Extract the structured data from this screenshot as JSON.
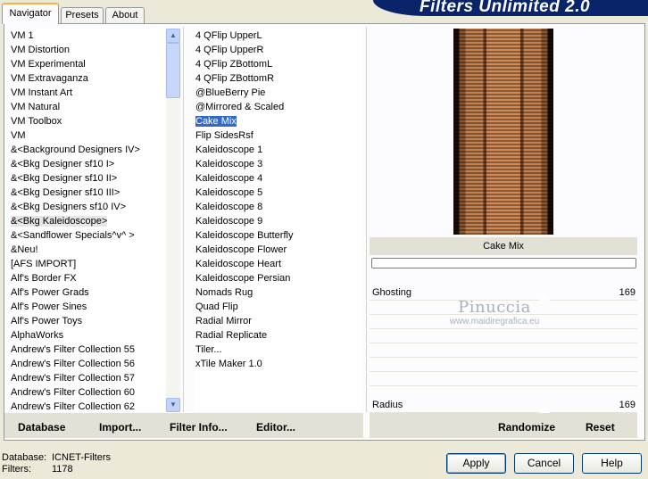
{
  "tabs": [
    "Navigator",
    "Presets",
    "About"
  ],
  "banner_title": "Filters Unlimited 2.0",
  "categories": [
    "VM 1",
    "VM Distortion",
    "VM Experimental",
    "VM Extravaganza",
    "VM Instant Art",
    "VM Natural",
    "VM Toolbox",
    "VM",
    "&<Background Designers IV>",
    "&<Bkg Designer sf10 I>",
    "&<Bkg Designer sf10 II>",
    "&<Bkg Designer sf10 III>",
    "&<Bkg Designers sf10 IV>",
    "&<Bkg Kaleidoscope>",
    "&<Sandflower Specials^v^ >",
    "&Neu!",
    "[AFS IMPORT]",
    "Alf's Border FX",
    "Alf's Power Grads",
    "Alf's Power Sines",
    "Alf's Power Toys",
    "AlphaWorks",
    "Andrew's Filter Collection 55",
    "Andrew's Filter Collection 56",
    "Andrew's Filter Collection 57",
    "Andrew's Filter Collection 60",
    "Andrew's Filter Collection 62"
  ],
  "selected_category": "&<Bkg Kaleidoscope>",
  "filters": [
    "4 QFlip UpperL",
    "4 QFlip UpperR",
    "4 QFlip ZBottomL",
    "4 QFlip ZBottomR",
    "@BlueBerry Pie",
    "@Mirrored & Scaled",
    "Cake Mix",
    "Flip SidesRsf",
    "Kaleidoscope 1",
    "Kaleidoscope 3",
    "Kaleidoscope 4",
    "Kaleidoscope 5",
    "Kaleidoscope 8",
    "Kaleidoscope 9",
    "Kaleidoscope Butterfly",
    "Kaleidoscope Flower",
    "Kaleidoscope Heart",
    "Kaleidoscope Persian",
    "Nomads Rug",
    "Quad Flip",
    "Radial Mirror",
    "Radial Replicate",
    "Tiler...",
    "xTile Maker 1.0"
  ],
  "selected_filter": "Cake Mix",
  "preview_name": "Cake Mix",
  "params": [
    {
      "label": "Ghosting",
      "value": "169"
    },
    {
      "label": "Radius",
      "value": "169"
    }
  ],
  "watermark": {
    "name": "Pinuccia",
    "url": "www.maidiregrafica.eu"
  },
  "toolbar": {
    "database": "Database",
    "import": "Import...",
    "filter_info": "Filter Info...",
    "editor": "Editor...",
    "randomize": "Randomize",
    "reset": "Reset"
  },
  "status": {
    "database_label": "Database:",
    "database_value": "ICNET-Filters",
    "filters_label": "Filters:",
    "filters_value": "1178"
  },
  "buttons": {
    "apply": "Apply",
    "cancel": "Cancel",
    "help": "Help"
  },
  "colors": {
    "title_bar": "#0a246a",
    "selection": "#316ac5",
    "window_bg": "#ece9d8"
  }
}
